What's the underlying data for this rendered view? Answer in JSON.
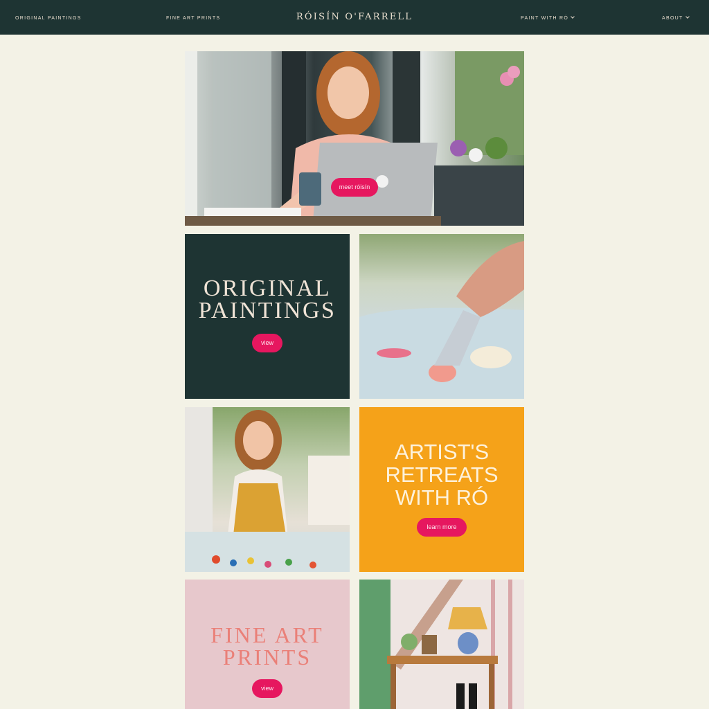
{
  "nav": {
    "original_paintings": "ORIGINAL PAINTINGS",
    "fine_art_prints": "FINE ART PRINTS",
    "brand": "RÓISÍN O'FARRELL",
    "paint_with_ro": "PAINT WITH RÓ",
    "about": "ABOUT"
  },
  "hero": {
    "button": "meet róisín"
  },
  "tiles": {
    "original_paintings": {
      "line1": "ORIGINAL",
      "line2": "PAINTINGS",
      "button": "view"
    },
    "retreats": {
      "line1": "ARTIST'S",
      "line2": "RETREATS",
      "line3": "WITH RÓ",
      "button": "learn more"
    },
    "prints": {
      "line1": "FINE ART",
      "line2": "PRINTS",
      "button": "view"
    }
  },
  "colors": {
    "nav_bg": "#1e3433",
    "page_bg": "#f3f2e6",
    "accent_pink": "#e6175f",
    "orange": "#f5a219",
    "blush": "#e7c8cc"
  }
}
